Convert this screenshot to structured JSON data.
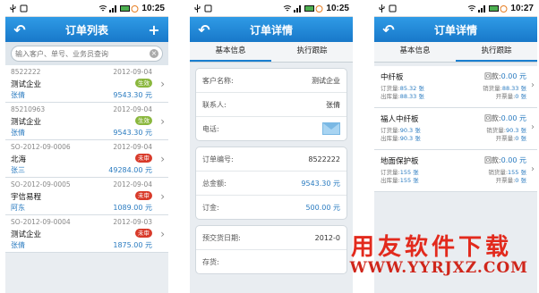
{
  "status": {
    "screen1_time": "10:25",
    "screen2_time": "10:25",
    "screen3_time": "10:27"
  },
  "screen1": {
    "title": "订单列表",
    "back_icon": "back-arrow-icon",
    "add_icon": "plus-icon",
    "search_placeholder": "输入客户、单号、业务员查询",
    "orders": [
      {
        "number": "8522222",
        "date": "2012-09-04",
        "company": "测试企业",
        "status": "生效",
        "status_color": "#8ab73d",
        "person": "张倩",
        "amount": "9543.30 元"
      },
      {
        "number": "85210963",
        "date": "2012-09-04",
        "company": "测试企业",
        "status": "生效",
        "status_color": "#8ab73d",
        "person": "张倩",
        "amount": "9543.30 元"
      },
      {
        "number": "SO-2012-09-0006",
        "date": "2012-09-04",
        "company": "北海",
        "status": "未审",
        "status_color": "#d83a2a",
        "person": "张三",
        "amount": "49284.00 元"
      },
      {
        "number": "SO-2012-09-0005",
        "date": "2012-09-04",
        "company": "宇信易程",
        "status": "未审",
        "status_color": "#d83a2a",
        "person": "阿东",
        "amount": "1089.00 元"
      },
      {
        "number": "SO-2012-09-0004",
        "date": "2012-09-03",
        "company": "测试企业",
        "status": "未审",
        "status_color": "#d83a2a",
        "person": "张倩",
        "amount": "1875.00 元"
      }
    ]
  },
  "screen2": {
    "title": "订单详情",
    "tabs": [
      "基本信息",
      "执行跟踪"
    ],
    "card1": {
      "customer_label": "客户名称:",
      "customer_value": "测试企业",
      "contact_label": "联系人:",
      "contact_value": "张倩",
      "phone_label": "电话:"
    },
    "card2": {
      "order_no_label": "订单编号:",
      "order_no_value": "8522222",
      "total_label": "总金额:",
      "total_value": "9543.30 元",
      "deposit_label": "订金:",
      "deposit_value": "500.00 元"
    },
    "card3": {
      "delivery_label": "预交货日期:",
      "delivery_value": "2012-0",
      "stock_label": "存货:"
    }
  },
  "screen3": {
    "title": "订单详情",
    "tabs": [
      "基本信息",
      "执行跟踪"
    ],
    "products": [
      {
        "name": "中纤板",
        "returned_label": "回款:",
        "returned": "0.00 元",
        "ordered_label": "订货量:",
        "ordered": "85.32 张",
        "sold_label": "销货量:",
        "sold": "88.33 张",
        "shipped_label": "出库量:",
        "shipped": "88.33 张",
        "invoiced_label": "开票量:",
        "invoiced": "0 张"
      },
      {
        "name": "福人中纤板",
        "returned_label": "回款:",
        "returned": "0.00 元",
        "ordered_label": "订货量:",
        "ordered": "90.3 张",
        "sold_label": "销货量:",
        "sold": "90.3 张",
        "shipped_label": "出库量:",
        "shipped": "90.3 张",
        "invoiced_label": "开票量:",
        "invoiced": "0 张"
      },
      {
        "name": "地面保护板",
        "returned_label": "回款:",
        "returned": "0.00 元",
        "ordered_label": "订货量:",
        "ordered": "155 张",
        "sold_label": "销货量:",
        "sold": "155 张",
        "shipped_label": "出库量:",
        "shipped": "155 张",
        "invoiced_label": "开票量:",
        "invoiced": "0 张"
      }
    ]
  },
  "watermark": {
    "text": "用友软件下载",
    "url": "WWW.YYRJXZ.COM"
  },
  "colors": {
    "titlebar": "#1a7fd0",
    "accent_blue": "#2a7bc0",
    "status_green": "#8ab73d",
    "status_red": "#d83a2a",
    "watermark_red": "#e22a1d"
  }
}
